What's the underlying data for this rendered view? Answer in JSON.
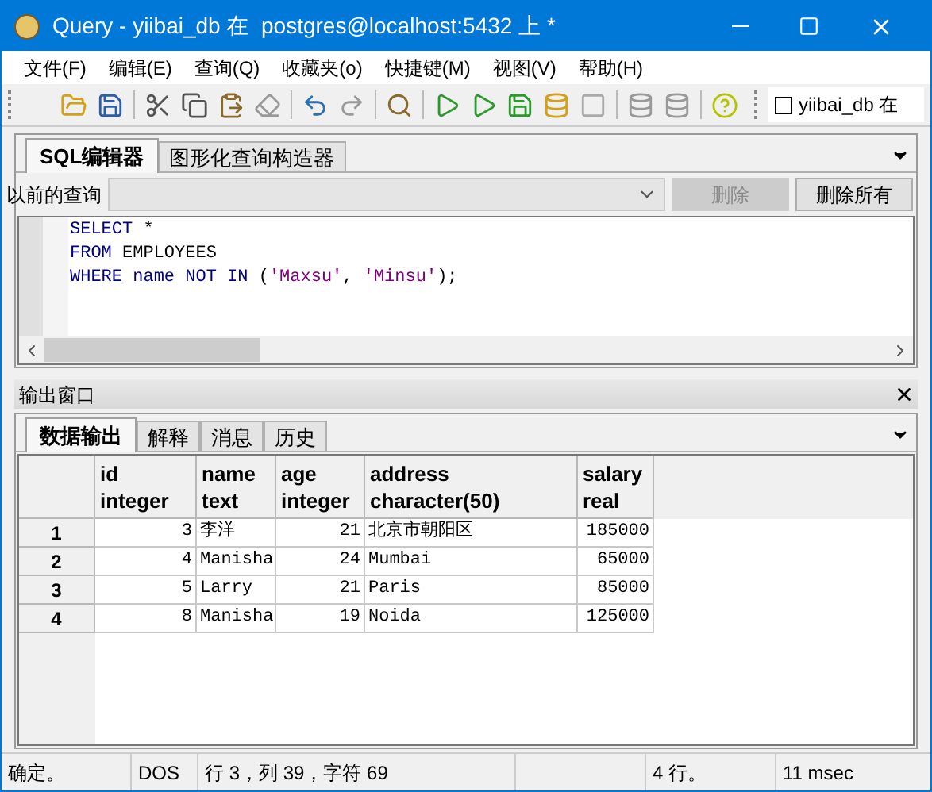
{
  "window": {
    "title": "Query - yiibai_db 在  postgres@localhost:5432 上 *"
  },
  "menu": [
    "文件(F)",
    "编辑(E)",
    "查询(Q)",
    "收藏夹(o)",
    "快捷键(M)",
    "视图(V)",
    "帮助(H)"
  ],
  "toolbar": {
    "database_checked": false,
    "database_label": "yiibai_db 在"
  },
  "editor_tabs": [
    {
      "label": "SQL编辑器",
      "selected": true
    },
    {
      "label": "图形化查询构造器",
      "selected": false
    }
  ],
  "previous_queries": {
    "label": "以前的查询",
    "buttons": [
      {
        "label": "删除",
        "disabled": true
      },
      {
        "label": "删除所有",
        "disabled": false
      }
    ]
  },
  "sql_lines": [
    [
      {
        "text": "SELECT",
        "kind": "keyword"
      },
      {
        "text": " *",
        "kind": "plain"
      }
    ],
    [
      {
        "text": "FROM",
        "kind": "keyword"
      },
      {
        "text": " EMPLOYEES",
        "kind": "plain"
      }
    ],
    [
      {
        "text": "WHERE",
        "kind": "keyword"
      },
      {
        "text": " name ",
        "kind": "keyword"
      },
      {
        "text": "NOT IN",
        "kind": "keyword"
      },
      {
        "text": " (",
        "kind": "plain"
      },
      {
        "text": "'Maxsu'",
        "kind": "string"
      },
      {
        "text": ", ",
        "kind": "plain"
      },
      {
        "text": "'Minsu'",
        "kind": "string"
      },
      {
        "text": ");",
        "kind": "plain"
      }
    ]
  ],
  "output": {
    "title": "输出窗口",
    "tabs": [
      {
        "label": "数据输出",
        "selected": true
      },
      {
        "label": "解释",
        "selected": false
      },
      {
        "label": "消息",
        "selected": false
      },
      {
        "label": "历史",
        "selected": false
      }
    ],
    "columns": [
      {
        "name": "id",
        "type": "integer"
      },
      {
        "name": "name",
        "type": "text"
      },
      {
        "name": "age",
        "type": "integer"
      },
      {
        "name": "address",
        "type": "character(50)"
      },
      {
        "name": "salary",
        "type": "real"
      }
    ],
    "rows": [
      {
        "number": "1",
        "cells": [
          "3",
          "李洋",
          "21",
          "北京市朝阳区",
          "185000"
        ]
      },
      {
        "number": "2",
        "cells": [
          "4",
          "Manisha",
          "24",
          "Mumbai",
          "65000"
        ]
      },
      {
        "number": "3",
        "cells": [
          "5",
          "Larry",
          "21",
          "Paris",
          "85000"
        ]
      },
      {
        "number": "4",
        "cells": [
          "8",
          "Manisha",
          "19",
          "Noida",
          "125000"
        ]
      }
    ]
  },
  "status_bar": [
    "确定。",
    "DOS",
    "行 3，列 39，字符 69",
    "4 行。",
    "11 msec"
  ]
}
